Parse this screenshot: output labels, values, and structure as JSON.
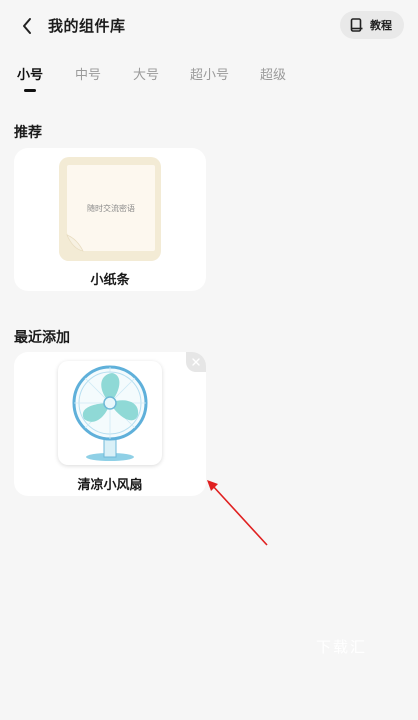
{
  "header": {
    "title": "我的组件库",
    "tutorial_label": "教程"
  },
  "tabs": [
    {
      "label": "小号",
      "active": true
    },
    {
      "label": "中号",
      "active": false
    },
    {
      "label": "大号",
      "active": false
    },
    {
      "label": "超小号",
      "active": false
    },
    {
      "label": "超级",
      "active": false
    }
  ],
  "recommended": {
    "title": "推荐",
    "items": [
      {
        "name": "小纸条",
        "preview_text": "随时交流密语"
      }
    ]
  },
  "recent": {
    "title": "最近添加",
    "items": [
      {
        "name": "清凉小风扇"
      }
    ]
  },
  "watermark": "下载汇",
  "colors": {
    "background": "#f6f6f6",
    "card": "#ffffff",
    "fan_blade": "#8fd9d6",
    "fan_frame": "#5fb0da",
    "arrow": "#e02020"
  }
}
